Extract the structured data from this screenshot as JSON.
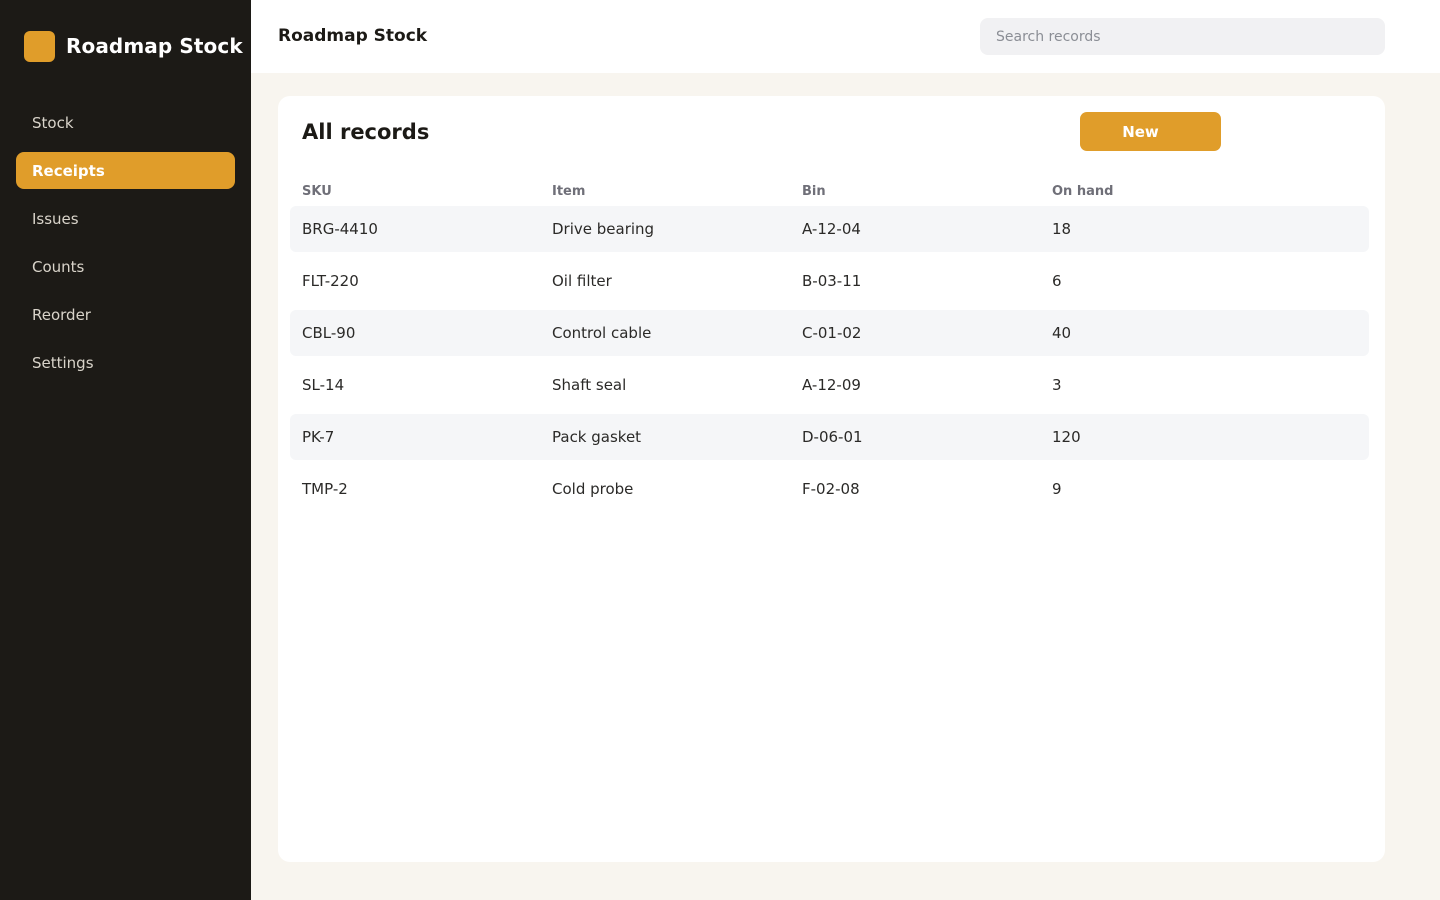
{
  "brand": {
    "name": "Roadmap Stock",
    "logo_color": "#e09d2a"
  },
  "sidebar": {
    "items": [
      {
        "label": "Stock",
        "active": false
      },
      {
        "label": "Receipts",
        "active": true
      },
      {
        "label": "Issues",
        "active": false
      },
      {
        "label": "Counts",
        "active": false
      },
      {
        "label": "Reorder",
        "active": false
      },
      {
        "label": "Settings",
        "active": false
      }
    ]
  },
  "topbar": {
    "title": "Roadmap Stock",
    "search_placeholder": "Search records"
  },
  "main": {
    "title": "All records",
    "new_label": "New",
    "columns": [
      "SKU",
      "Item",
      "Bin",
      "On hand"
    ],
    "rows": [
      [
        "BRG-4410",
        "Drive bearing",
        "A-12-04",
        "18"
      ],
      [
        "FLT-220",
        "Oil filter",
        "B-03-11",
        "6"
      ],
      [
        "CBL-90",
        "Control cable",
        "C-01-02",
        "40"
      ],
      [
        "SL-14",
        "Shaft seal",
        "A-12-09",
        "3"
      ],
      [
        "PK-7",
        "Pack gasket",
        "D-06-01",
        "120"
      ],
      [
        "TMP-2",
        "Cold probe",
        "F-02-08",
        "9"
      ]
    ]
  },
  "colors": {
    "accent": "#e09d2a",
    "sidebar_bg": "#1c1a16",
    "page_bg": "#f8f5ef"
  }
}
